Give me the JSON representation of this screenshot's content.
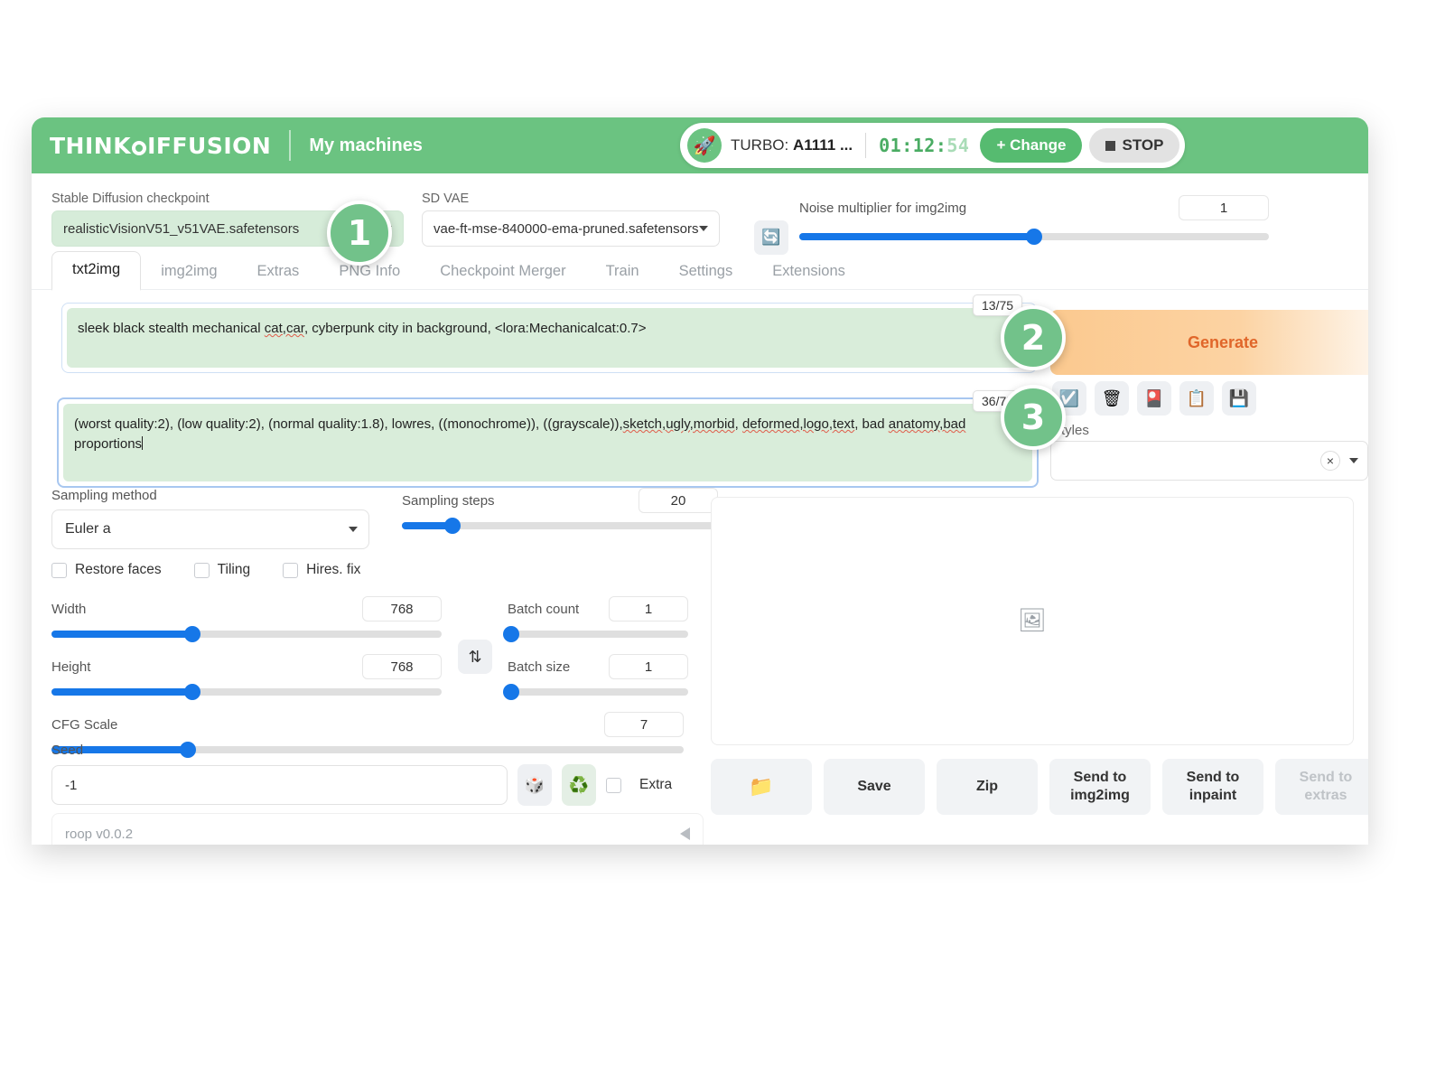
{
  "header": {
    "logo_think": "THINK",
    "logo_diffusion": "IFFUSION",
    "subtitle": "My machines",
    "rocket_icon": "🚀",
    "machine_label": "TURBO: ",
    "machine_name": "A1111 ...",
    "timer_main": "01:12:",
    "timer_dim": "54",
    "change_label": "+ Change",
    "stop_label": "STOP"
  },
  "model_row": {
    "checkpoint_label": "Stable Diffusion checkpoint",
    "checkpoint_value": "realisticVisionV51_v51VAE.safetensors",
    "vae_label": "SD VAE",
    "vae_value": "vae-ft-mse-840000-ema-pruned.safetensors",
    "refresh_icon": "🔄",
    "noise_label": "Noise multiplier for img2img",
    "noise_value": "1"
  },
  "tabs": [
    {
      "label": "txt2img",
      "active": true
    },
    {
      "label": "img2img",
      "active": false
    },
    {
      "label": "Extras",
      "active": false
    },
    {
      "label": "PNG Info",
      "active": false
    },
    {
      "label": "Checkpoint Merger",
      "active": false
    },
    {
      "label": "Train",
      "active": false
    },
    {
      "label": "Settings",
      "active": false
    },
    {
      "label": "Extensions",
      "active": false
    }
  ],
  "prompts": {
    "positive_a": "sleek black stealth mechanical ",
    "positive_spell": "cat,car",
    "positive_b": ",  cyberpunk city in background, <lora:Mechanicalcat:0.7>",
    "positive_tokens": "13/75",
    "negative_a": "(worst quality:2), (low quality:2), (normal quality:1.8), lowres, ((monochrome)), ((grayscale)),",
    "negative_spell1": "sketch,ugly,morbid",
    "negative_mid1": ", ",
    "negative_spell2": "deformed,logo,text",
    "negative_mid2": ", bad ",
    "negative_spell3": "anatomy,bad",
    "negative_end": " proportions",
    "negative_tokens": "36/75"
  },
  "generate": {
    "label": "Generate",
    "icons": [
      {
        "name": "check-blue-icon",
        "glyph": "☑️"
      },
      {
        "name": "trash-icon",
        "glyph": "🗑"
      },
      {
        "name": "card-pink-icon",
        "glyph": "🎴"
      },
      {
        "name": "clipboard-icon",
        "glyph": "📋"
      },
      {
        "name": "floppy-save-icon",
        "glyph": "💾"
      }
    ],
    "styles_label": "Styles",
    "styles_clear": "×"
  },
  "params": {
    "sampling_method_label": "Sampling method",
    "sampling_method_value": "Euler a",
    "sampling_steps_label": "Sampling steps",
    "sampling_steps_value": "20",
    "checkboxes": [
      {
        "label": "Restore faces",
        "checked": false
      },
      {
        "label": "Tiling",
        "checked": false
      },
      {
        "label": "Hires. fix",
        "checked": false
      }
    ],
    "width_label": "Width",
    "width_value": "768",
    "height_label": "Height",
    "height_value": "768",
    "cfg_label": "CFG Scale",
    "cfg_value": "7",
    "batch_count_label": "Batch count",
    "batch_count_value": "1",
    "batch_size_label": "Batch size",
    "batch_size_value": "1",
    "swap_icon": "⇅",
    "seed_label": "Seed",
    "seed_value": "-1",
    "dice_icon": "🎲",
    "recycle_icon": "♻️",
    "extra_label": "Extra",
    "roop_label": "roop v0.0.2"
  },
  "output": {
    "placeholder_icon": "🖼",
    "buttons": [
      {
        "label": "📁",
        "kind": "folder",
        "faded": false
      },
      {
        "label": "Save",
        "kind": "text",
        "faded": false
      },
      {
        "label": "Zip",
        "kind": "text",
        "faded": false
      },
      {
        "label": "Send to img2img",
        "kind": "text",
        "faded": false
      },
      {
        "label": "Send to inpaint",
        "kind": "text",
        "faded": false
      },
      {
        "label": "Send to extras",
        "kind": "text",
        "faded": true
      }
    ]
  },
  "badges": [
    {
      "number": "1"
    },
    {
      "number": "2"
    },
    {
      "number": "3"
    }
  ],
  "colors": {
    "brand_green": "#6bc381",
    "accent_blue": "#1677e8",
    "generate_orange": "#e0662a",
    "prompt_green": "#d9edda"
  }
}
